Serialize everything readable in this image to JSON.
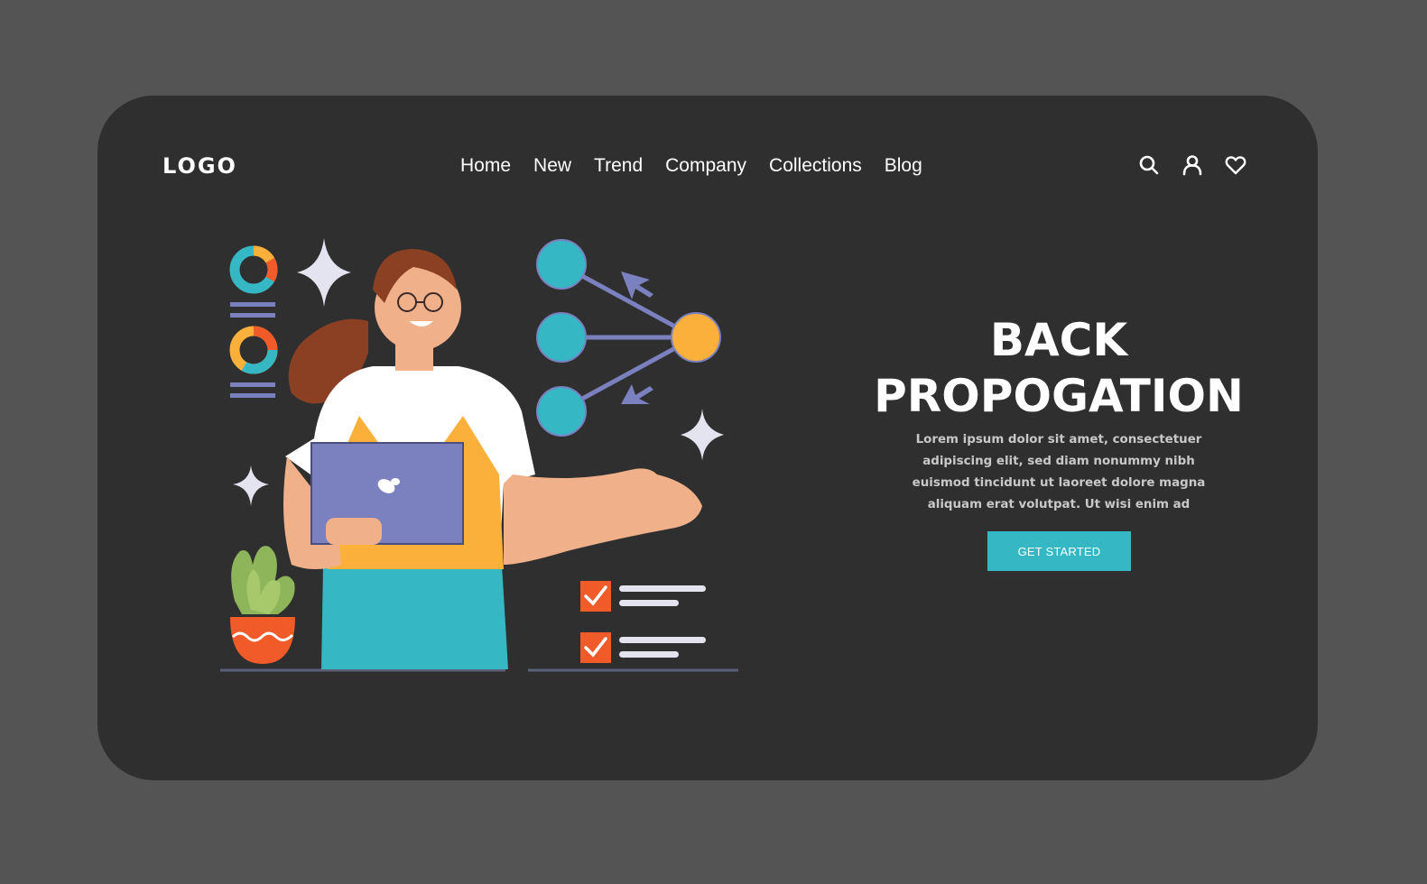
{
  "header": {
    "logo": "LOGO",
    "nav": [
      "Home",
      "New",
      "Trend",
      "Company",
      "Collections",
      "Blog"
    ],
    "icons": [
      "search-icon",
      "user-icon",
      "heart-icon"
    ]
  },
  "hero": {
    "title_line1": "BACK",
    "title_line2": "PROPOGATION",
    "description": "Lorem ipsum dolor sit amet, consectetuer adipiscing elit, sed diam nonummy nibh euismod tincidunt ut laoreet dolore magna aliquam erat volutpat. Ut wisi enim ad",
    "cta_label": "GET STARTED"
  },
  "colors": {
    "background": "#545454",
    "card": "#2f2f2f",
    "accent_teal": "#36b8c4",
    "accent_orange": "#fbb03b",
    "accent_red": "#f15a29",
    "accent_purple": "#7b80bf",
    "text": "#ffffff"
  }
}
